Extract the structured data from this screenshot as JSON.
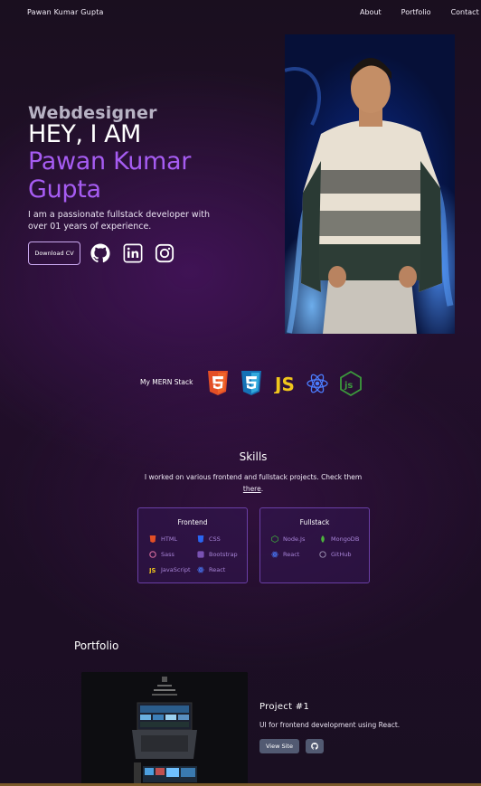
{
  "nav": {
    "brand": "Pawan Kumar Gupta",
    "links": [
      {
        "label": "About"
      },
      {
        "label": "Portfolio"
      },
      {
        "label": "Contact"
      }
    ]
  },
  "hero": {
    "role": "Webdesigner",
    "greeting": "HEY, I AM",
    "name": "Pawan Kumar Gupta",
    "intro": "I am a passionate fullstack developer with over 01 years of experience.",
    "download_cv": "Download CV",
    "social_icons": [
      "github-icon",
      "linkedin-icon",
      "instagram-icon"
    ]
  },
  "stack": {
    "label": "My MERN Stack",
    "icons": [
      "html5-icon",
      "css3-icon",
      "javascript-icon",
      "react-icon",
      "nodejs-icon"
    ]
  },
  "skills": {
    "title": "Skills",
    "desc_before": "I worked on various frontend and fullstack projects. Check them ",
    "desc_link": "there",
    "desc_after": ".",
    "frontend": {
      "title": "Frontend",
      "items": [
        {
          "label": "HTML",
          "icon": "html5-icon",
          "color": "#e34f26"
        },
        {
          "label": "CSS",
          "icon": "css3-icon",
          "color": "#264de4"
        },
        {
          "label": "Sass",
          "icon": "sass-icon",
          "color": "#cd6799"
        },
        {
          "label": "Bootstrap",
          "icon": "bootstrap-icon",
          "color": "#7952b3"
        },
        {
          "label": "JavaScript",
          "icon": "javascript-icon",
          "color": "#f0db4f"
        },
        {
          "label": "React",
          "icon": "react-icon",
          "color": "#61dafb"
        }
      ]
    },
    "fullstack": {
      "title": "Fullstack",
      "items": [
        {
          "label": "Node.Js",
          "icon": "nodejs-icon",
          "color": "#3c873a"
        },
        {
          "label": "MongoDB",
          "icon": "mongodb-icon",
          "color": "#4db33d"
        },
        {
          "label": "React",
          "icon": "react-icon",
          "color": "#61dafb"
        },
        {
          "label": "GitHub",
          "icon": "github-icon",
          "color": "#c9c9c9"
        }
      ]
    }
  },
  "portfolio": {
    "title": "Portfolio",
    "projects": [
      {
        "name": "Project #1",
        "description": "UI for frontend development using React.",
        "view_label": "View Site"
      }
    ]
  },
  "colors": {
    "accent": "#a65cf2",
    "background": "#1f0f26"
  }
}
